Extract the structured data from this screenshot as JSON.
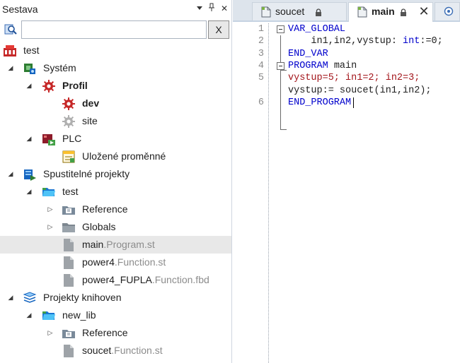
{
  "panel": {
    "title": "Sestava",
    "pin_glyph": "▾",
    "dock_glyph": "📌",
    "close_glyph": "✕",
    "search_value": "",
    "clear_label": "X"
  },
  "tree": [
    {
      "label": "test",
      "ext": "",
      "icon": "project-icon",
      "level": 0,
      "arrow": "",
      "bold": false
    },
    {
      "label": "Systém",
      "ext": "",
      "icon": "system-icon",
      "level": 1,
      "arrow": "◢",
      "bold": false
    },
    {
      "label": "Profil",
      "ext": "",
      "icon": "gear-icon",
      "level": 2,
      "arrow": "◢",
      "bold": true
    },
    {
      "label": "dev",
      "ext": "",
      "icon": "gear-icon",
      "level": 3,
      "arrow": "",
      "bold": true
    },
    {
      "label": "site",
      "ext": "",
      "icon": "gear-gray-icon",
      "level": 3,
      "arrow": "",
      "bold": false
    },
    {
      "label": "PLC",
      "ext": "",
      "icon": "plc-icon",
      "level": 2,
      "arrow": "◢",
      "bold": false
    },
    {
      "label": "Uložené proměnné",
      "ext": "",
      "icon": "variables-icon",
      "level": 3,
      "arrow": "",
      "bold": false
    },
    {
      "label": "Spustitelné projekty",
      "ext": "",
      "icon": "executable-icon",
      "level": 1,
      "arrow": "◢",
      "bold": false
    },
    {
      "label": "test",
      "ext": "",
      "icon": "folder-open-icon",
      "level": 2,
      "arrow": "◢",
      "bold": false
    },
    {
      "label": "Reference",
      "ext": "",
      "icon": "reference-icon",
      "level": 3,
      "arrow": "▷",
      "bold": false
    },
    {
      "label": "Globals",
      "ext": "",
      "icon": "folder-icon",
      "level": 3,
      "arrow": "▷",
      "bold": false
    },
    {
      "label": "main",
      "ext": ".Program.st",
      "icon": "file-icon",
      "level": 3,
      "arrow": "",
      "bold": false,
      "selected": true
    },
    {
      "label": "power4",
      "ext": ".Function.st",
      "icon": "file-icon",
      "level": 3,
      "arrow": "",
      "bold": false
    },
    {
      "label": "power4_FUPLA",
      "ext": ".Function.fbd",
      "icon": "file-icon",
      "level": 3,
      "arrow": "",
      "bold": false
    },
    {
      "label": "Projekty knihoven",
      "ext": "",
      "icon": "library-icon",
      "level": 1,
      "arrow": "◢",
      "bold": false
    },
    {
      "label": "new_lib",
      "ext": "",
      "icon": "folder-open-icon",
      "level": 2,
      "arrow": "◢",
      "bold": false
    },
    {
      "label": "Reference",
      "ext": "",
      "icon": "reference-icon",
      "level": 3,
      "arrow": "▷",
      "bold": false
    },
    {
      "label": "soucet",
      "ext": ".Function.st",
      "icon": "file-icon",
      "level": 3,
      "arrow": "",
      "bold": false
    }
  ],
  "tabs": {
    "soucet": "soucet",
    "main": "main",
    "close_glyph": "✕"
  },
  "code": {
    "line_numbers": [
      "1",
      "2",
      "3",
      "4",
      "5",
      "",
      "6"
    ],
    "lines": [
      [
        {
          "t": "VAR_GLOBAL",
          "c": "kw"
        }
      ],
      [
        {
          "t": "    in1,in2,vystup: ",
          "c": "txt"
        },
        {
          "t": "int",
          "c": "kw"
        },
        {
          "t": ":=0;",
          "c": "txt"
        }
      ],
      [
        {
          "t": "END_VAR",
          "c": "kw"
        }
      ],
      [
        {
          "t": "PROGRAM",
          "c": "kw"
        },
        {
          "t": " main",
          "c": "txt"
        }
      ],
      [
        {
          "t": "vystup=5; in1=2; in2=3;",
          "c": "red"
        }
      ],
      [
        {
          "t": "vystup:= soucet(in1,in2);",
          "c": "txt"
        }
      ],
      [
        {
          "t": "END_PROGRAM",
          "c": "kw"
        }
      ]
    ]
  },
  "colors": {
    "keyword": "#0000cc",
    "error_line": "#a3151b",
    "selected_row": "#e8e8e8",
    "tabbar": "#dde4ec"
  }
}
